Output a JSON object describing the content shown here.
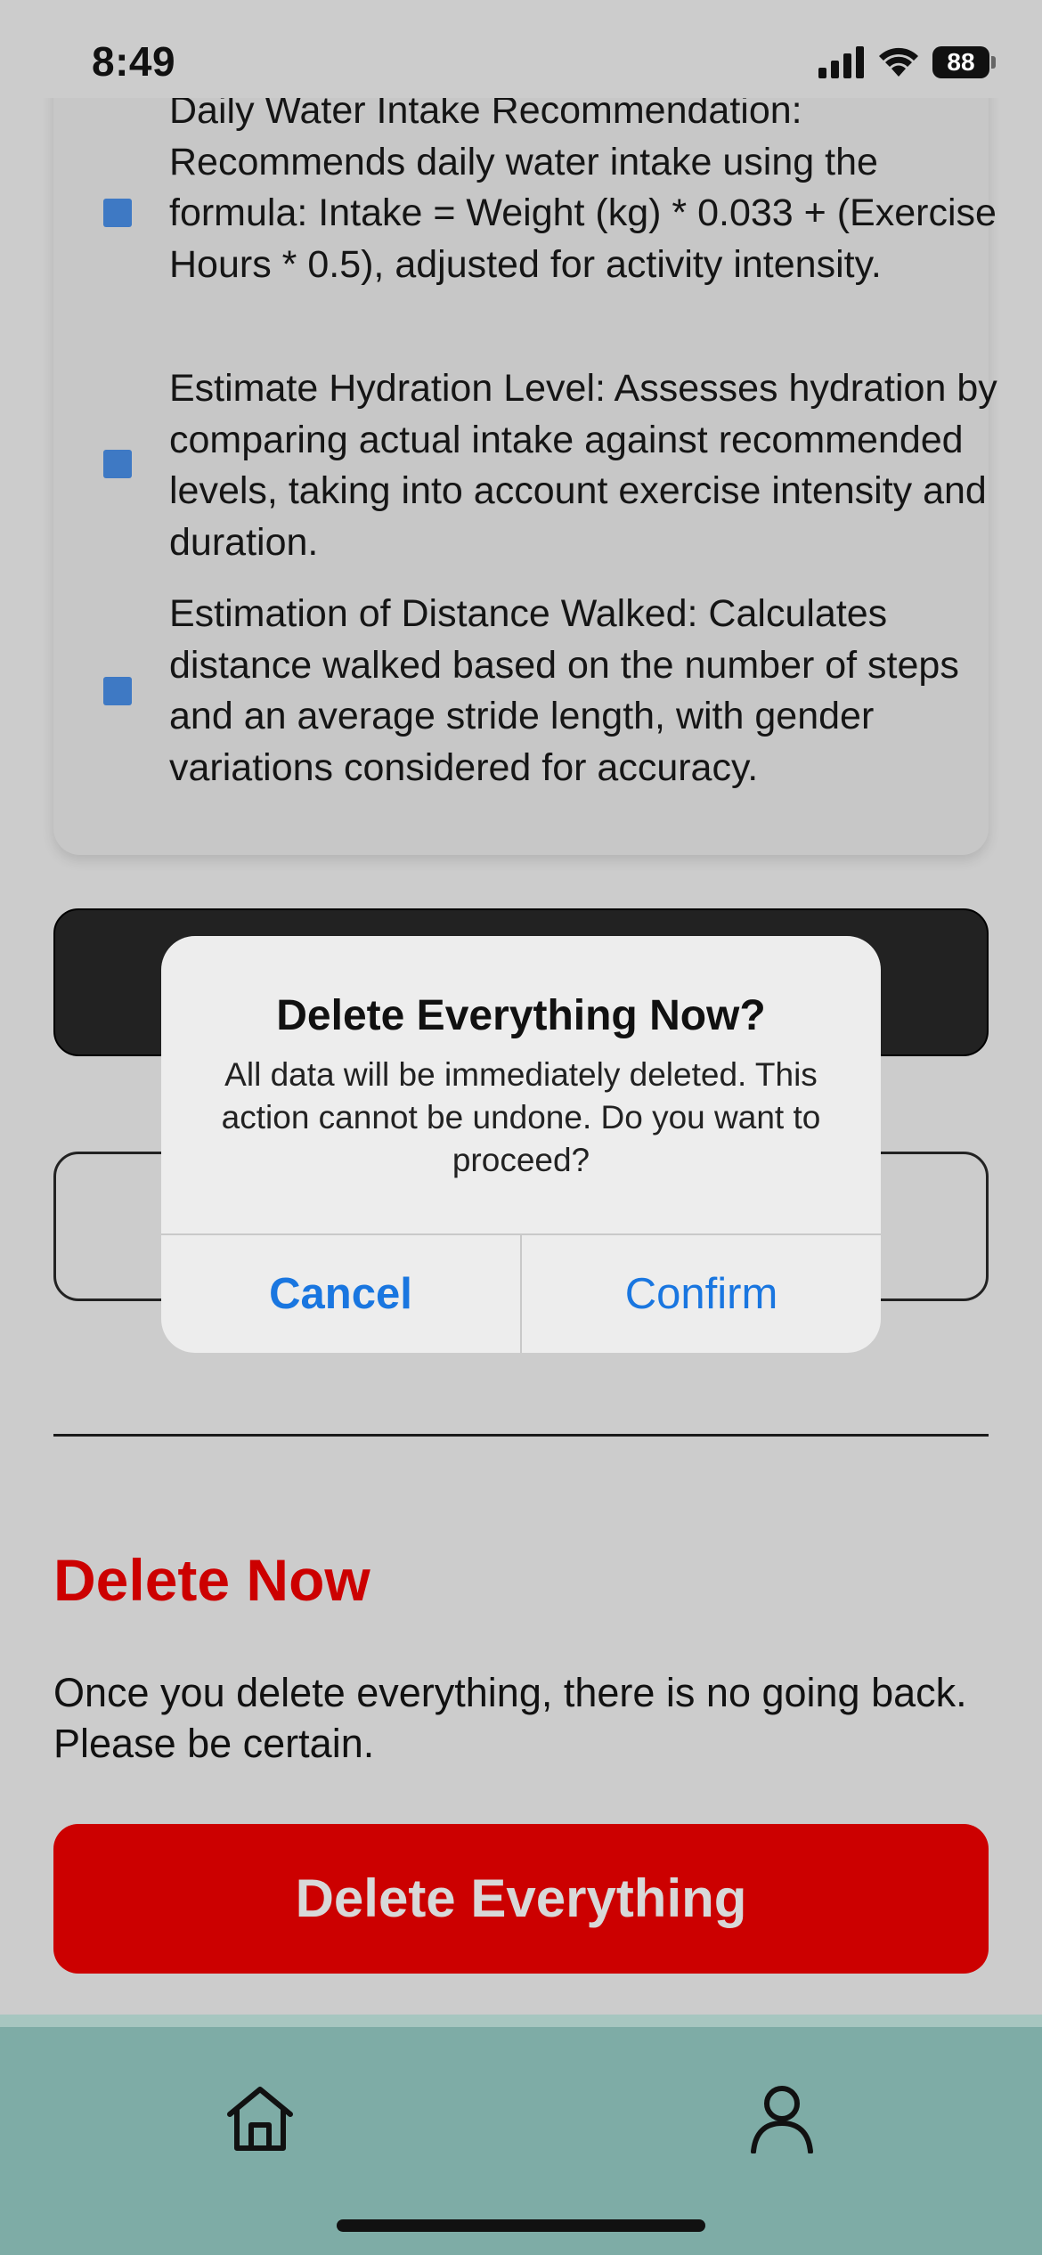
{
  "status_bar": {
    "time": "8:49",
    "battery": "88",
    "signal_icon": "cellular-signal-icon",
    "wifi_icon": "wifi-icon"
  },
  "features": [
    {
      "text": "Daily Water Intake Recommendation: Recommends daily water intake using the formula: Intake = Weight (kg) * 0.033 + (Exercise Hours * 0.5), adjusted for activity intensity."
    },
    {
      "text": "Estimate Hydration Level: Assesses hydration by comparing actual intake against recommended levels, taking into account exercise intensity and duration."
    },
    {
      "text": "Estimation of Distance Walked: Calculates distance walked based on the number of steps and an average stride length, with gender variations considered for accuracy."
    }
  ],
  "danger_zone": {
    "title": "Delete Now",
    "description": "Once you delete everything, there is no going back. Please be certain.",
    "button_label": "Delete Everything"
  },
  "modal": {
    "title": "Delete Everything Now?",
    "message": "All data will be immediately deleted. This action cannot be undone. Do you want to proceed?",
    "cancel_label": "Cancel",
    "confirm_label": "Confirm"
  },
  "bottom_nav": {
    "items": [
      {
        "icon": "home-icon"
      },
      {
        "icon": "profile-icon"
      }
    ]
  },
  "colors": {
    "accent": "#1976e0",
    "danger": "#cc0000",
    "bullet": "#3e79c4",
    "nav_background": "#7eaca6"
  }
}
